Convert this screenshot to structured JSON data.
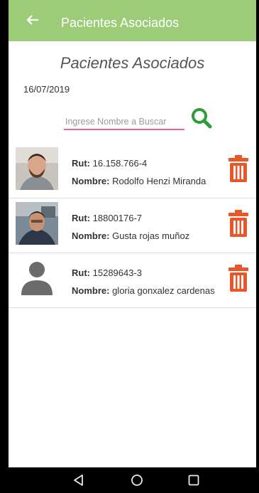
{
  "appbar": {
    "title": "Pacientes Asociados"
  },
  "heading": "Pacientes Asociados",
  "date": "16/07/2019",
  "search": {
    "placeholder": "Ingrese Nombre a Buscar",
    "value": ""
  },
  "labels": {
    "rut": "Rut:",
    "nombre": "Nombre:"
  },
  "patients": [
    {
      "rut": "16.158.766-4",
      "nombre": "Rodolfo Henzi Miranda"
    },
    {
      "rut": "18800176-7",
      "nombre": "Gusta rojas muñoz"
    },
    {
      "rut": "15289643-3",
      "nombre": "gloria gonxalez cardenas"
    }
  ],
  "icons": {
    "back": "arrow-left-icon",
    "search": "magnifier-icon",
    "delete": "trash-icon",
    "nav": [
      "back-triangle-icon",
      "home-circle-icon",
      "recents-square-icon"
    ]
  },
  "colors": {
    "appbar": "#9ccc78",
    "trash": "#e8572b",
    "search_icon": "#2e9b3a",
    "input_underline": "#e3679e"
  }
}
